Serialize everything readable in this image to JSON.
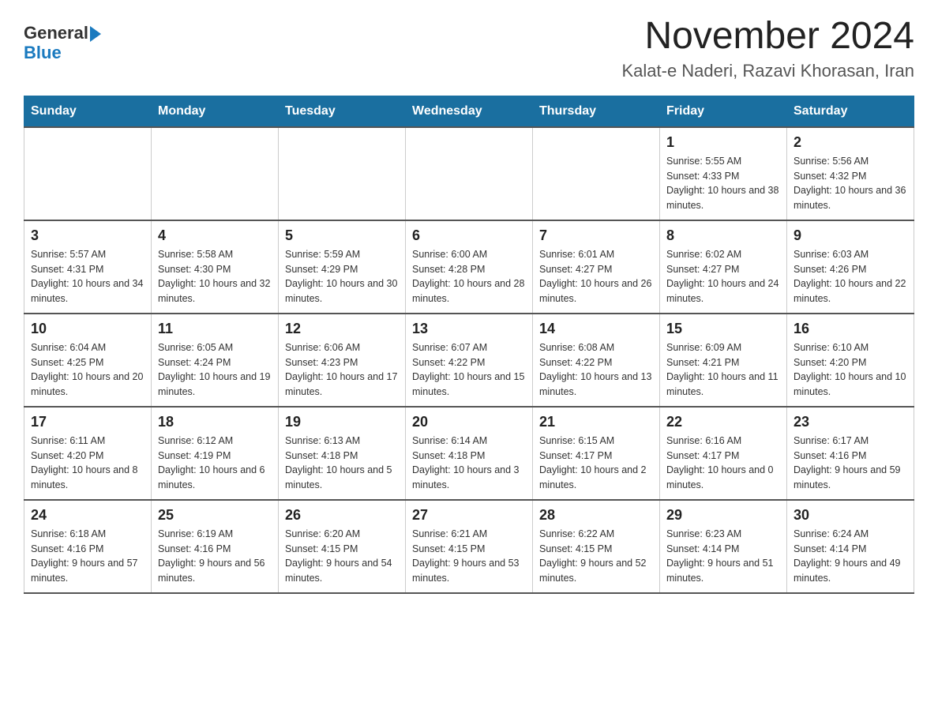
{
  "header": {
    "logo_general": "General",
    "logo_blue": "Blue",
    "month_title": "November 2024",
    "location": "Kalat-e Naderi, Razavi Khorasan, Iran"
  },
  "days_of_week": [
    "Sunday",
    "Monday",
    "Tuesday",
    "Wednesday",
    "Thursday",
    "Friday",
    "Saturday"
  ],
  "weeks": [
    [
      {
        "day": "",
        "info": ""
      },
      {
        "day": "",
        "info": ""
      },
      {
        "day": "",
        "info": ""
      },
      {
        "day": "",
        "info": ""
      },
      {
        "day": "",
        "info": ""
      },
      {
        "day": "1",
        "info": "Sunrise: 5:55 AM\nSunset: 4:33 PM\nDaylight: 10 hours and 38 minutes."
      },
      {
        "day": "2",
        "info": "Sunrise: 5:56 AM\nSunset: 4:32 PM\nDaylight: 10 hours and 36 minutes."
      }
    ],
    [
      {
        "day": "3",
        "info": "Sunrise: 5:57 AM\nSunset: 4:31 PM\nDaylight: 10 hours and 34 minutes."
      },
      {
        "day": "4",
        "info": "Sunrise: 5:58 AM\nSunset: 4:30 PM\nDaylight: 10 hours and 32 minutes."
      },
      {
        "day": "5",
        "info": "Sunrise: 5:59 AM\nSunset: 4:29 PM\nDaylight: 10 hours and 30 minutes."
      },
      {
        "day": "6",
        "info": "Sunrise: 6:00 AM\nSunset: 4:28 PM\nDaylight: 10 hours and 28 minutes."
      },
      {
        "day": "7",
        "info": "Sunrise: 6:01 AM\nSunset: 4:27 PM\nDaylight: 10 hours and 26 minutes."
      },
      {
        "day": "8",
        "info": "Sunrise: 6:02 AM\nSunset: 4:27 PM\nDaylight: 10 hours and 24 minutes."
      },
      {
        "day": "9",
        "info": "Sunrise: 6:03 AM\nSunset: 4:26 PM\nDaylight: 10 hours and 22 minutes."
      }
    ],
    [
      {
        "day": "10",
        "info": "Sunrise: 6:04 AM\nSunset: 4:25 PM\nDaylight: 10 hours and 20 minutes."
      },
      {
        "day": "11",
        "info": "Sunrise: 6:05 AM\nSunset: 4:24 PM\nDaylight: 10 hours and 19 minutes."
      },
      {
        "day": "12",
        "info": "Sunrise: 6:06 AM\nSunset: 4:23 PM\nDaylight: 10 hours and 17 minutes."
      },
      {
        "day": "13",
        "info": "Sunrise: 6:07 AM\nSunset: 4:22 PM\nDaylight: 10 hours and 15 minutes."
      },
      {
        "day": "14",
        "info": "Sunrise: 6:08 AM\nSunset: 4:22 PM\nDaylight: 10 hours and 13 minutes."
      },
      {
        "day": "15",
        "info": "Sunrise: 6:09 AM\nSunset: 4:21 PM\nDaylight: 10 hours and 11 minutes."
      },
      {
        "day": "16",
        "info": "Sunrise: 6:10 AM\nSunset: 4:20 PM\nDaylight: 10 hours and 10 minutes."
      }
    ],
    [
      {
        "day": "17",
        "info": "Sunrise: 6:11 AM\nSunset: 4:20 PM\nDaylight: 10 hours and 8 minutes."
      },
      {
        "day": "18",
        "info": "Sunrise: 6:12 AM\nSunset: 4:19 PM\nDaylight: 10 hours and 6 minutes."
      },
      {
        "day": "19",
        "info": "Sunrise: 6:13 AM\nSunset: 4:18 PM\nDaylight: 10 hours and 5 minutes."
      },
      {
        "day": "20",
        "info": "Sunrise: 6:14 AM\nSunset: 4:18 PM\nDaylight: 10 hours and 3 minutes."
      },
      {
        "day": "21",
        "info": "Sunrise: 6:15 AM\nSunset: 4:17 PM\nDaylight: 10 hours and 2 minutes."
      },
      {
        "day": "22",
        "info": "Sunrise: 6:16 AM\nSunset: 4:17 PM\nDaylight: 10 hours and 0 minutes."
      },
      {
        "day": "23",
        "info": "Sunrise: 6:17 AM\nSunset: 4:16 PM\nDaylight: 9 hours and 59 minutes."
      }
    ],
    [
      {
        "day": "24",
        "info": "Sunrise: 6:18 AM\nSunset: 4:16 PM\nDaylight: 9 hours and 57 minutes."
      },
      {
        "day": "25",
        "info": "Sunrise: 6:19 AM\nSunset: 4:16 PM\nDaylight: 9 hours and 56 minutes."
      },
      {
        "day": "26",
        "info": "Sunrise: 6:20 AM\nSunset: 4:15 PM\nDaylight: 9 hours and 54 minutes."
      },
      {
        "day": "27",
        "info": "Sunrise: 6:21 AM\nSunset: 4:15 PM\nDaylight: 9 hours and 53 minutes."
      },
      {
        "day": "28",
        "info": "Sunrise: 6:22 AM\nSunset: 4:15 PM\nDaylight: 9 hours and 52 minutes."
      },
      {
        "day": "29",
        "info": "Sunrise: 6:23 AM\nSunset: 4:14 PM\nDaylight: 9 hours and 51 minutes."
      },
      {
        "day": "30",
        "info": "Sunrise: 6:24 AM\nSunset: 4:14 PM\nDaylight: 9 hours and 49 minutes."
      }
    ]
  ]
}
